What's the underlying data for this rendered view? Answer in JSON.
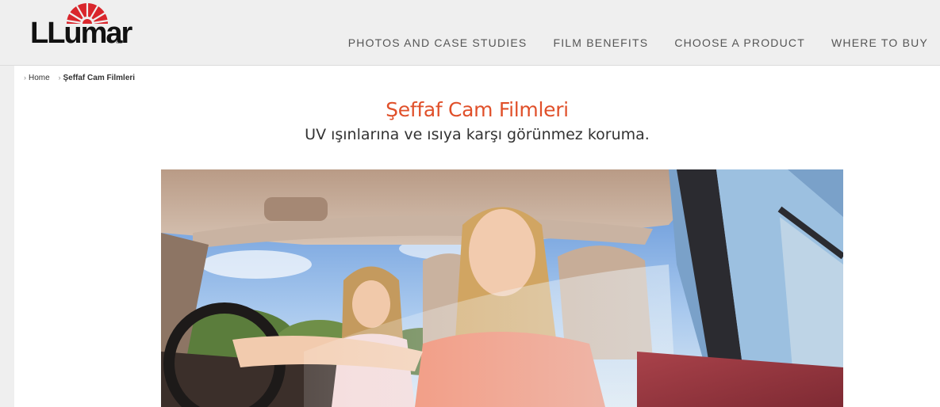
{
  "brand": {
    "name": "LLumar",
    "accent_color": "#e0502a",
    "logo_red": "#d9262c"
  },
  "nav": {
    "items": [
      {
        "label": "PHOTOS AND CASE STUDIES"
      },
      {
        "label": "FILM BENEFITS"
      },
      {
        "label": "CHOOSE A PRODUCT"
      },
      {
        "label": "WHERE TO BUY"
      }
    ]
  },
  "breadcrumb": {
    "home": "Home",
    "current": "Şeffaf Cam Filmleri"
  },
  "page": {
    "title": "Şeffaf Cam Filmleri",
    "subtitle": "UV ışınlarına ve ısıya karşı görünmez koruma."
  },
  "hero": {
    "icon": "car-interior-photo"
  }
}
